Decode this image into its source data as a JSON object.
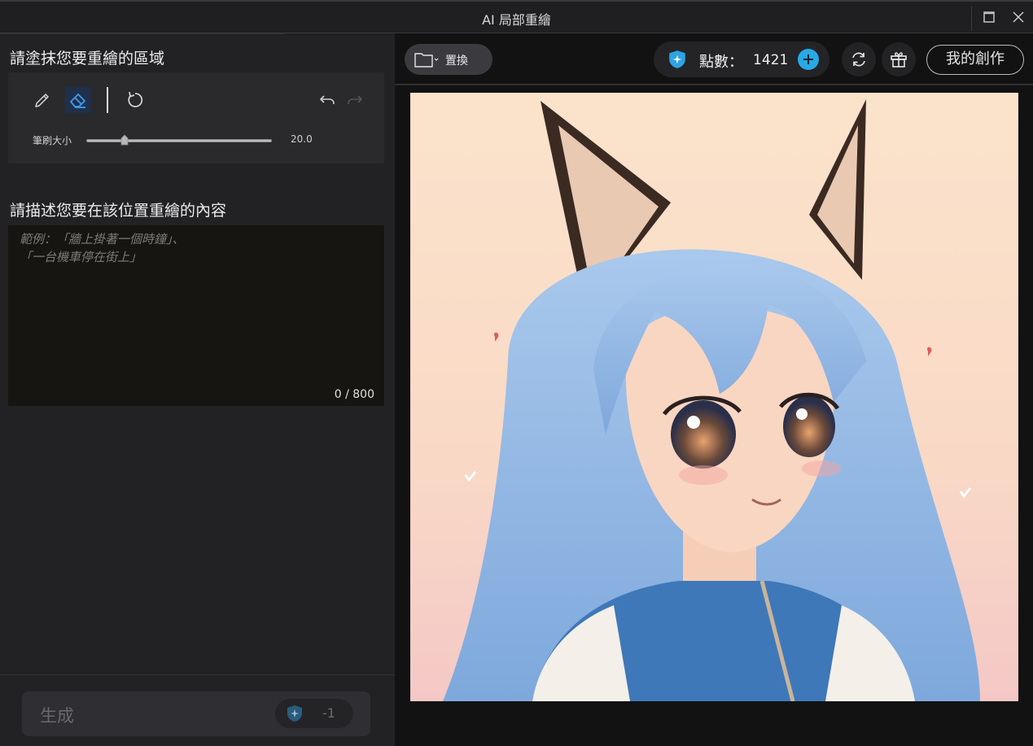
{
  "window": {
    "title": "AI 局部重繪"
  },
  "left": {
    "mask_title": "請塗抹您要重繪的區域",
    "brush": {
      "label": "筆刷大小",
      "value": "20.0",
      "fraction": 0.2
    },
    "prompt_title": "請描述您要在該位置重繪的內容",
    "prompt_placeholder": "範例：「牆上掛著一個時鐘」、\n「一台機車停在街上」",
    "counter": "0 / 800",
    "generate": {
      "label": "生成",
      "cost": "-1"
    }
  },
  "right": {
    "replace_label": "置換",
    "points_label": "點數：",
    "points_value": "1421",
    "my_works_label": "我的創作",
    "image": "anime-fox-girl-portrait"
  },
  "colors": {
    "accent": "#27a9e6",
    "active_tool_bg": "#20304a",
    "panel_bg": "#222225",
    "canvas_bg": "#121212"
  },
  "icons": {
    "brush": "brush-icon",
    "eraser": "eraser-icon",
    "reset": "reset-icon",
    "undo": "undo-icon",
    "redo": "redo-icon",
    "folder": "folder-icon",
    "shield": "shield-star-icon",
    "refresh": "refresh-icon",
    "gift": "gift-icon"
  }
}
